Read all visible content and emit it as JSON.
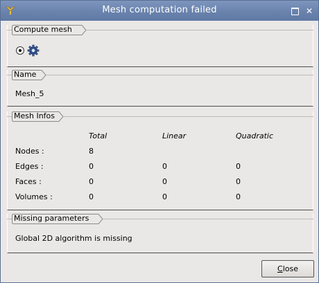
{
  "window": {
    "title": "Mesh computation failed"
  },
  "compute_mesh": {
    "label": "Compute mesh"
  },
  "name_section": {
    "label": "Name",
    "value": "Mesh_5"
  },
  "mesh_infos": {
    "label": "Mesh Infos",
    "columns": [
      "Total",
      "Linear",
      "Quadratic"
    ],
    "rows": [
      {
        "label": "Nodes :",
        "total": "8",
        "linear": "",
        "quadratic": ""
      },
      {
        "label": "Edges :",
        "total": "0",
        "linear": "0",
        "quadratic": "0"
      },
      {
        "label": "Faces :",
        "total": "0",
        "linear": "0",
        "quadratic": "0"
      },
      {
        "label": "Volumes :",
        "total": "0",
        "linear": "0",
        "quadratic": "0"
      }
    ]
  },
  "missing_params": {
    "label": "Missing parameters",
    "message": "Global 2D algorithm is missing"
  },
  "buttons": {
    "close_mnemonic": "C",
    "close_rest": "lose"
  }
}
